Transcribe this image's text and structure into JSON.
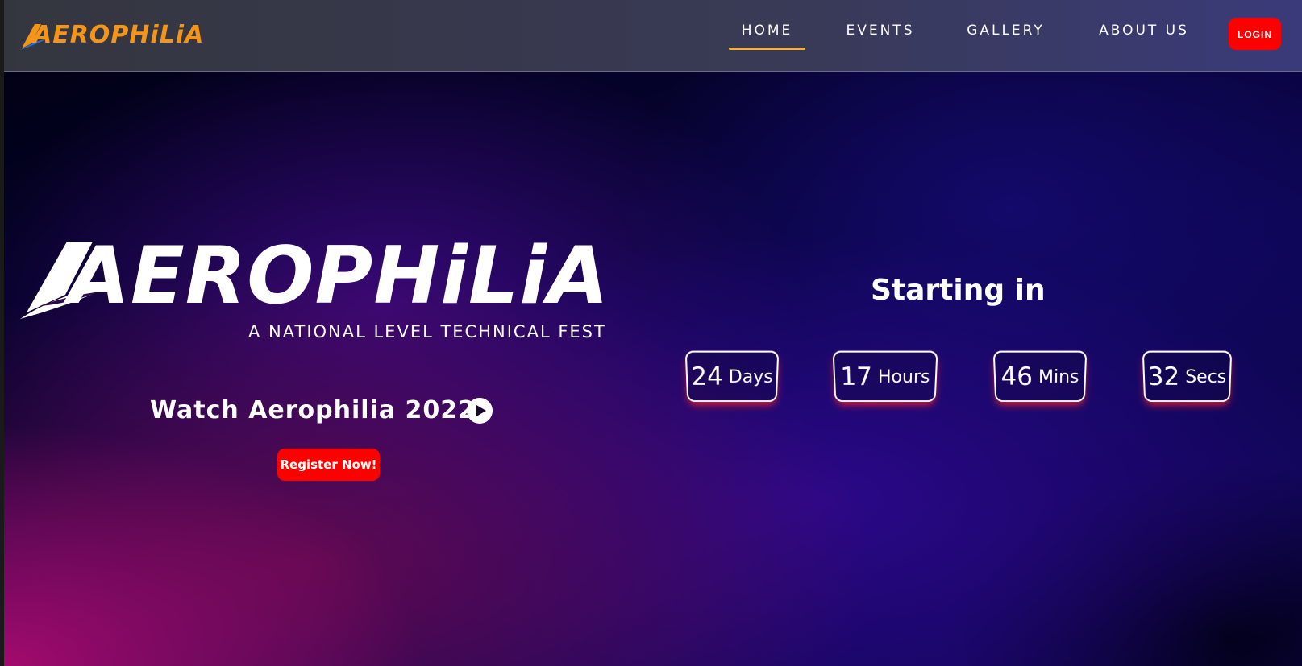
{
  "nav": {
    "logo_text": "AEROPHiLiA",
    "items": [
      {
        "label": "HOME",
        "active": true
      },
      {
        "label": "EVENTS",
        "active": false
      },
      {
        "label": "GALLERY",
        "active": false
      },
      {
        "label": "ABOUT US",
        "active": false
      }
    ],
    "login_label": "LOGIN"
  },
  "hero": {
    "logo_text": "AEROPHiLiA",
    "tagline": "A NATIONAL LEVEL TECHNICAL FEST",
    "watch_label": "Watch Aerophilia 2022",
    "register_label": "Register Now!"
  },
  "countdown": {
    "heading": "Starting in",
    "days": {
      "value": "24",
      "unit": "Days"
    },
    "hours": {
      "value": "17",
      "unit": "Hours"
    },
    "mins": {
      "value": "46",
      "unit": "Mins"
    },
    "secs": {
      "value": "32",
      "unit": "Secs"
    }
  },
  "colors": {
    "brand_orange": "#f4951a",
    "accent_red": "#ff0000",
    "nav_underline": "#f1b04a"
  },
  "icons": {
    "play": "play-circle-icon",
    "logo_swoosh": "swoosh-icon"
  }
}
